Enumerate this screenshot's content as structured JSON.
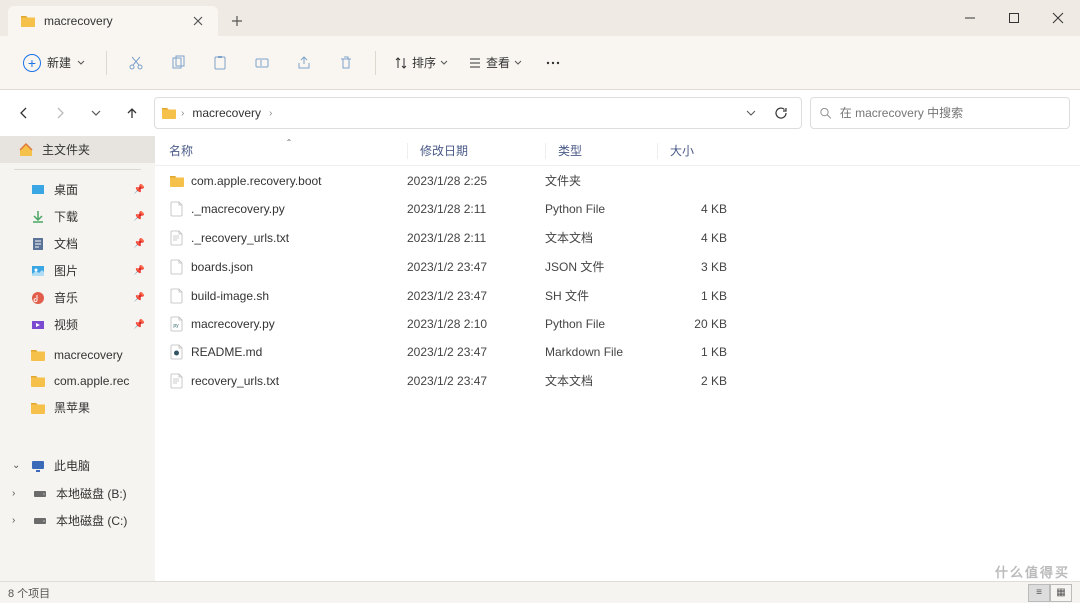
{
  "tab": {
    "title": "macrecovery"
  },
  "toolbar": {
    "new_label": "新建",
    "sort_label": "排序",
    "view_label": "查看"
  },
  "breadcrumb": {
    "segments": [
      "macrecovery"
    ]
  },
  "search": {
    "placeholder": "在 macrecovery 中搜索"
  },
  "sidebar": {
    "home": "主文件夹",
    "quick": [
      {
        "label": "桌面",
        "icon": "desktop",
        "color": "#3aa7e4"
      },
      {
        "label": "下载",
        "icon": "download",
        "color": "#4aa564"
      },
      {
        "label": "文档",
        "icon": "doc",
        "color": "#5b7396"
      },
      {
        "label": "图片",
        "icon": "pic",
        "color": "#3aa7e4"
      },
      {
        "label": "音乐",
        "icon": "music",
        "color": "#e05e4a"
      },
      {
        "label": "视频",
        "icon": "video",
        "color": "#7a4ad0"
      }
    ],
    "folders": [
      {
        "label": "macrecovery"
      },
      {
        "label": "com.apple.rec"
      },
      {
        "label": "黑苹果"
      }
    ],
    "thispc": "此电脑",
    "drives": [
      {
        "label": "本地磁盘 (B:)"
      },
      {
        "label": "本地磁盘 (C:)"
      }
    ]
  },
  "columns": {
    "name": "名称",
    "date": "修改日期",
    "type": "类型",
    "size": "大小"
  },
  "files": [
    {
      "name": "com.apple.recovery.boot",
      "date": "2023/1/28 2:25",
      "type": "文件夹",
      "size": "",
      "icon": "folder"
    },
    {
      "name": "._macrecovery.py",
      "date": "2023/1/28 2:11",
      "type": "Python File",
      "size": "4 KB",
      "icon": "file"
    },
    {
      "name": "._recovery_urls.txt",
      "date": "2023/1/28 2:11",
      "type": "文本文档",
      "size": "4 KB",
      "icon": "txt"
    },
    {
      "name": "boards.json",
      "date": "2023/1/2 23:47",
      "type": "JSON 文件",
      "size": "3 KB",
      "icon": "file"
    },
    {
      "name": "build-image.sh",
      "date": "2023/1/2 23:47",
      "type": "SH 文件",
      "size": "1 KB",
      "icon": "file"
    },
    {
      "name": "macrecovery.py",
      "date": "2023/1/28 2:10",
      "type": "Python File",
      "size": "20 KB",
      "icon": "py"
    },
    {
      "name": "README.md",
      "date": "2023/1/2 23:47",
      "type": "Markdown File",
      "size": "1 KB",
      "icon": "md"
    },
    {
      "name": "recovery_urls.txt",
      "date": "2023/1/2 23:47",
      "type": "文本文档",
      "size": "2 KB",
      "icon": "txt"
    }
  ],
  "status": {
    "count": "8 个项目"
  },
  "watermark": "什么值得买"
}
